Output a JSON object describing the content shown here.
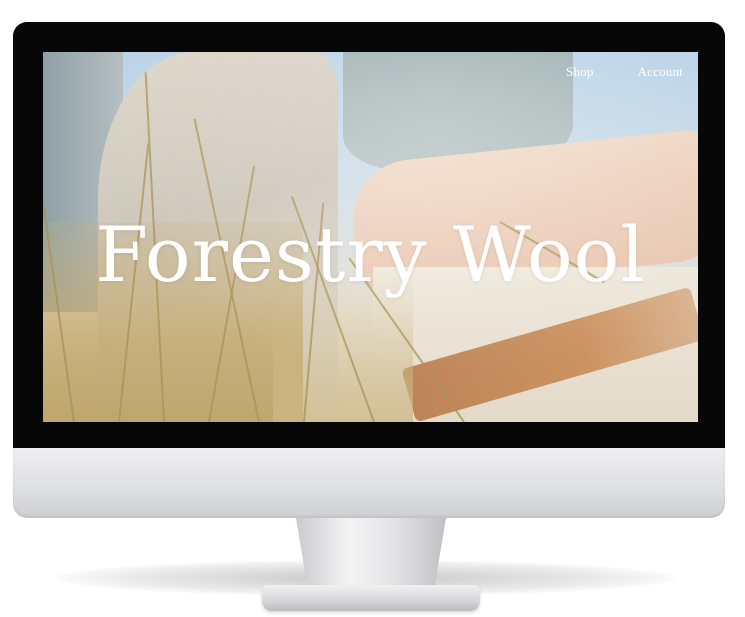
{
  "site": {
    "title": "Forestry Wool",
    "nav": [
      {
        "label": "Shop"
      },
      {
        "label": "Account"
      }
    ]
  },
  "colors": {
    "bezel": "#070707",
    "nav_text": "#ffffff",
    "title_text": "#ffffff",
    "stand_silver": "#d6d7da"
  },
  "icons": []
}
